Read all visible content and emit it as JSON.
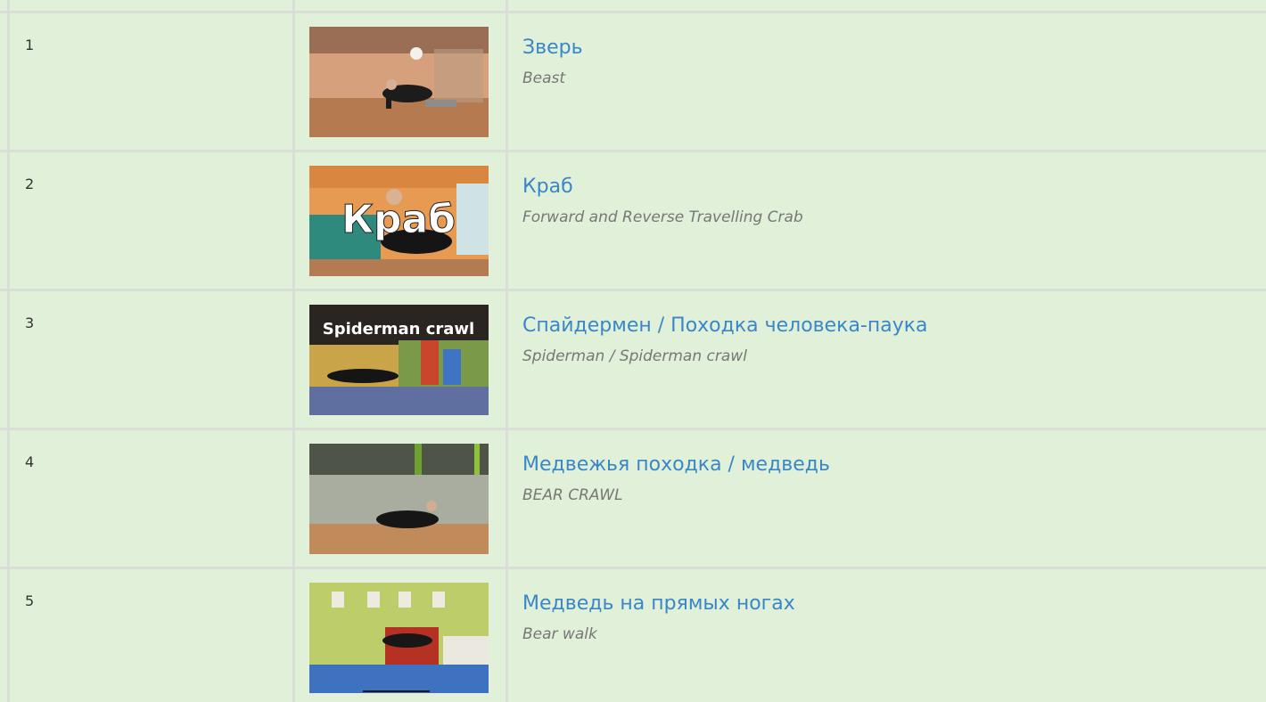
{
  "rows": [
    {
      "num": "1",
      "title": "Зверь",
      "subtitle": "Beast",
      "thumb": "beast-video-thumbnail",
      "overlay": ""
    },
    {
      "num": "2",
      "title": "Краб",
      "subtitle": "Forward and Reverse Travelling Crab",
      "thumb": "crab-video-thumbnail",
      "overlay": "Краб"
    },
    {
      "num": "3",
      "title": "Спайдермен / Походка человека-паука",
      "subtitle": "Spiderman / Spiderman crawl",
      "thumb": "spiderman-video-thumbnail",
      "overlay": "Spiderman crawl"
    },
    {
      "num": "4",
      "title": "Медвежья походка / медведь",
      "subtitle": "BEAR CRAWL",
      "thumb": "bear-crawl-video-thumbnail",
      "overlay": ""
    },
    {
      "num": "5",
      "title": "Медведь на прямых ногах",
      "subtitle": "Bear walk",
      "thumb": "bear-walk-video-thumbnail",
      "overlay": ""
    }
  ],
  "colors": {
    "row_bg": "#e1f0d8",
    "border": "#d9ded6",
    "link": "#3a87c8",
    "subtitle": "#777777"
  }
}
